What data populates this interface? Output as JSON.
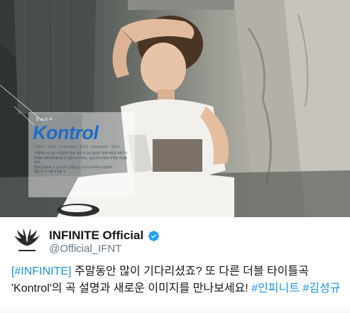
{
  "photo": {
    "track_label": "Track 4",
    "title": "Kontrol",
    "credits": "LYRICS · 김성규 · COMPOSED · 김성규 · ARRANGED · 김성규",
    "body_lines": [
      "\"어둠에는 한 번도 더 잡히지 말자, 마음 속 깊이 숨어든 내게 박동을 쳐줘\" 이",
      "꿈에서 새벽하게 펼쳐진 천 갈을 다세 쿠울는 김성규의 보컬과 딱딱한 기타를 화려",
      "함께 강렬하게 그 깊이 있는 흔들림 곧 가사가 오묘하고 다정하다.",
      "말할 것 처 이룰 지어를 곡."
    ]
  },
  "profile": {
    "display_name": "INFINITE Official",
    "handle": "@Official_IFNT",
    "verified_icon": "verified-badge-icon",
    "avatar_icon": "infinite-wings-logo-icon"
  },
  "tweet": {
    "hashtag_infinite": "[#INFINITE]",
    "text_part1": " 주말동안 많이 기다리셨죠? 또 다른 더블 타이틀곡",
    "text_part2": "'Kontrol'의 곡 설명과 새로운 이미지를 만나보세요! ",
    "hashtag_infinite_kr": "#인피니트",
    "hashtag_space": " ",
    "hashtag_kimsungkyu": "#김성규"
  },
  "colors": {
    "link": "#1b95e0",
    "title_blue": "#1f6cc9",
    "verified": "#1da1f2",
    "text": "#14171a",
    "handle": "#657786"
  }
}
